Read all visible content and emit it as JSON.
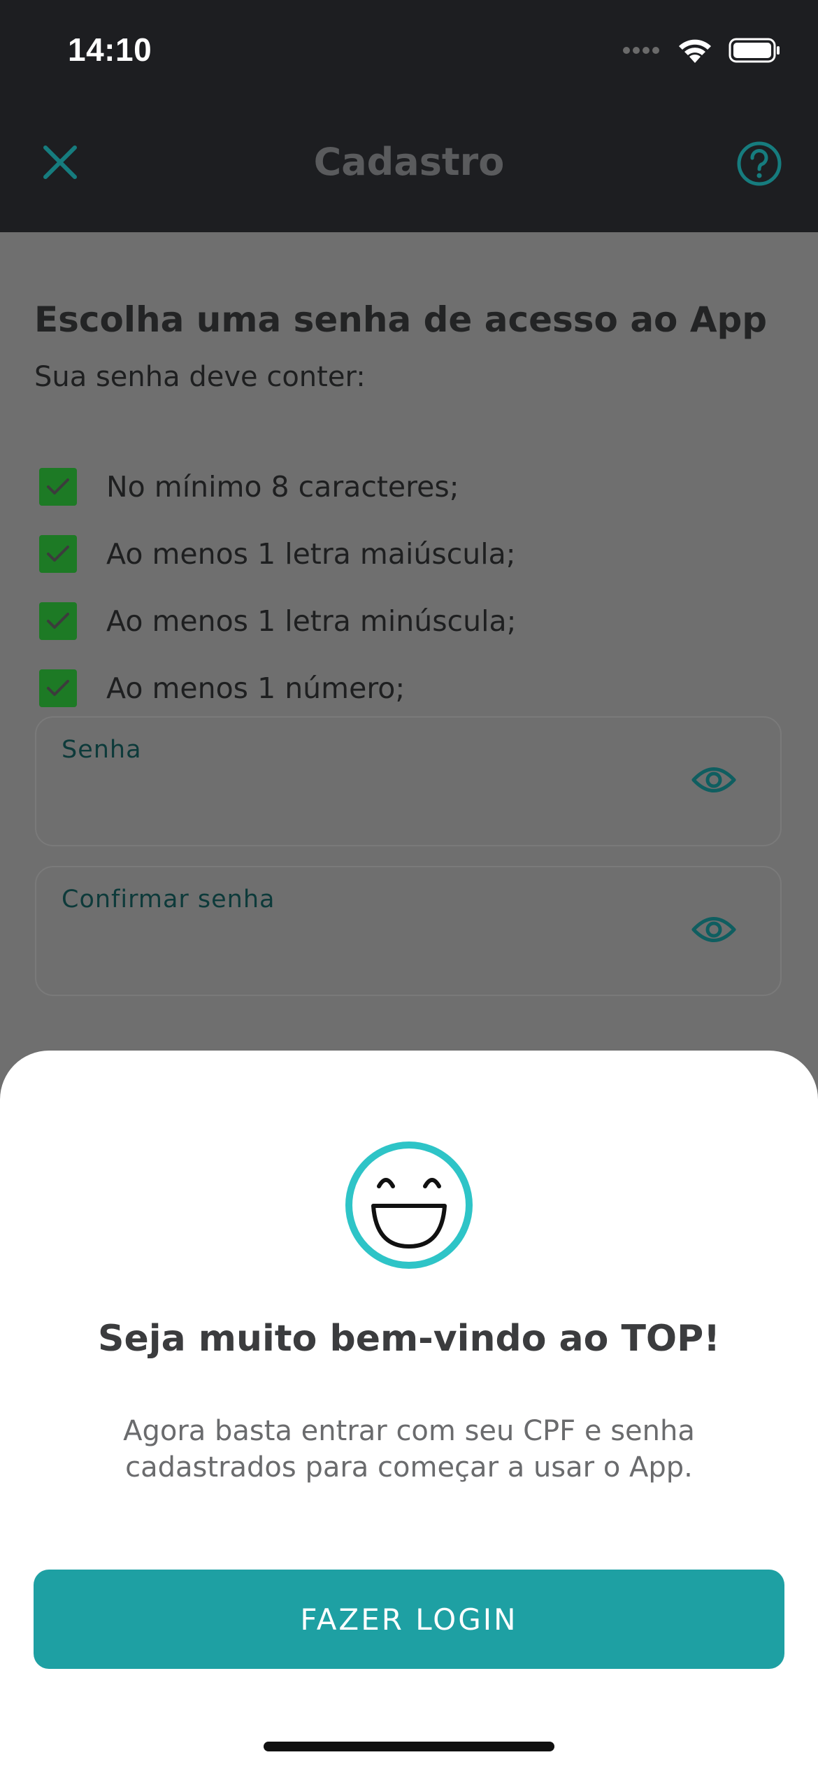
{
  "status_bar": {
    "time": "14:10"
  },
  "nav": {
    "title": "Cadastro",
    "close_icon": "close-icon",
    "help_icon": "help-circle-icon"
  },
  "form": {
    "title": "Escolha uma senha de acesso ao App",
    "subtitle": "Sua senha deve conter:",
    "requirements": [
      {
        "label": "No mínimo 8 caracteres;",
        "checked": true
      },
      {
        "label": "Ao menos 1 letra maiúscula;",
        "checked": true
      },
      {
        "label": "Ao menos 1 letra minúscula;",
        "checked": true
      },
      {
        "label": "Ao menos 1 número;",
        "checked": true
      }
    ],
    "password_field": {
      "label": "Senha",
      "value": ""
    },
    "confirm_field": {
      "label": "Confirmar senha",
      "value": ""
    }
  },
  "sheet": {
    "icon": "smiley-face-icon",
    "title": "Seja muito bem-vindo ao TOP!",
    "description": "Agora basta entrar com seu CPF e senha cadastrados para começar a usar o App.",
    "button_label": "FAZER LOGIN"
  },
  "colors": {
    "accent": "#1ea0a3",
    "check": "#1d7a25",
    "header": "#1d1e21"
  }
}
